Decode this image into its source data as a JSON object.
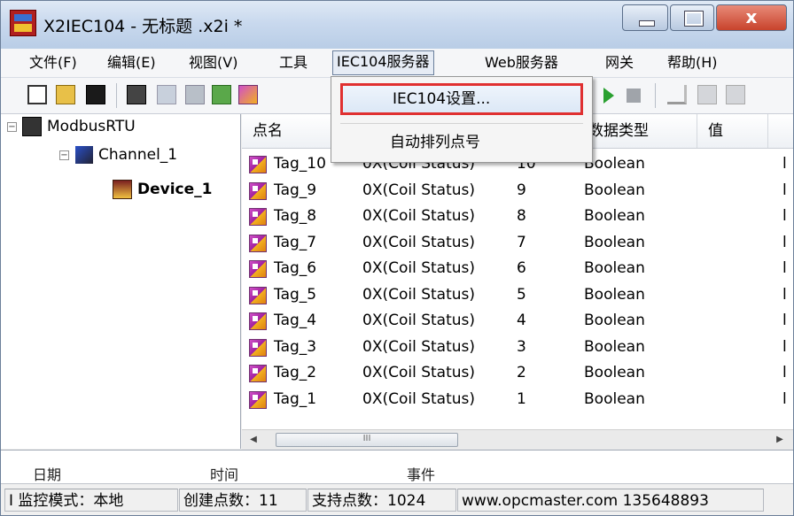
{
  "window": {
    "title": "X2IEC104 - 无标题 .x2i *",
    "close_glyph": "x"
  },
  "menu": [
    {
      "label": "文件(F)"
    },
    {
      "label": "编辑(E)"
    },
    {
      "label": "视图(V)"
    },
    {
      "label": "工具"
    },
    {
      "label": "IEC104服务器"
    },
    {
      "label": "Web服务器"
    },
    {
      "label": "网关"
    },
    {
      "label": "帮助(H)"
    }
  ],
  "dropdown": {
    "items": [
      {
        "label": "IEC104设置..."
      },
      {
        "label": "自动排列点号"
      }
    ]
  },
  "tree": {
    "root": "ModbusRTU",
    "channel": "Channel_1",
    "device": "Device_1"
  },
  "table": {
    "columns": [
      "点名",
      "",
      "",
      "数据类型",
      "值",
      ""
    ],
    "rows": [
      {
        "name": "Tag_10",
        "type": "0X(Coil Status)",
        "addr": "10",
        "dtype": "Boolean",
        "value": "",
        "extra": "l"
      },
      {
        "name": "Tag_9",
        "type": "0X(Coil Status)",
        "addr": "9",
        "dtype": "Boolean",
        "value": "",
        "extra": "l"
      },
      {
        "name": "Tag_8",
        "type": "0X(Coil Status)",
        "addr": "8",
        "dtype": "Boolean",
        "value": "",
        "extra": "l"
      },
      {
        "name": "Tag_7",
        "type": "0X(Coil Status)",
        "addr": "7",
        "dtype": "Boolean",
        "value": "",
        "extra": "l"
      },
      {
        "name": "Tag_6",
        "type": "0X(Coil Status)",
        "addr": "6",
        "dtype": "Boolean",
        "value": "",
        "extra": "l"
      },
      {
        "name": "Tag_5",
        "type": "0X(Coil Status)",
        "addr": "5",
        "dtype": "Boolean",
        "value": "",
        "extra": "l"
      },
      {
        "name": "Tag_4",
        "type": "0X(Coil Status)",
        "addr": "4",
        "dtype": "Boolean",
        "value": "",
        "extra": "l"
      },
      {
        "name": "Tag_3",
        "type": "0X(Coil Status)",
        "addr": "3",
        "dtype": "Boolean",
        "value": "",
        "extra": "l"
      },
      {
        "name": "Tag_2",
        "type": "0X(Coil Status)",
        "addr": "2",
        "dtype": "Boolean",
        "value": "",
        "extra": "l"
      },
      {
        "name": "Tag_1",
        "type": "0X(Coil Status)",
        "addr": "1",
        "dtype": "Boolean",
        "value": "",
        "extra": "l"
      }
    ]
  },
  "scrollbar": {
    "thumb_grip": "III"
  },
  "log": {
    "col_date": "日期",
    "col_time": "时间",
    "col_event": "事件"
  },
  "status": {
    "mode": "I 监控模式：本地",
    "created": "创建点数：11",
    "supported": "支持点数：1024",
    "site": "www.opcmaster.com 135648893"
  }
}
